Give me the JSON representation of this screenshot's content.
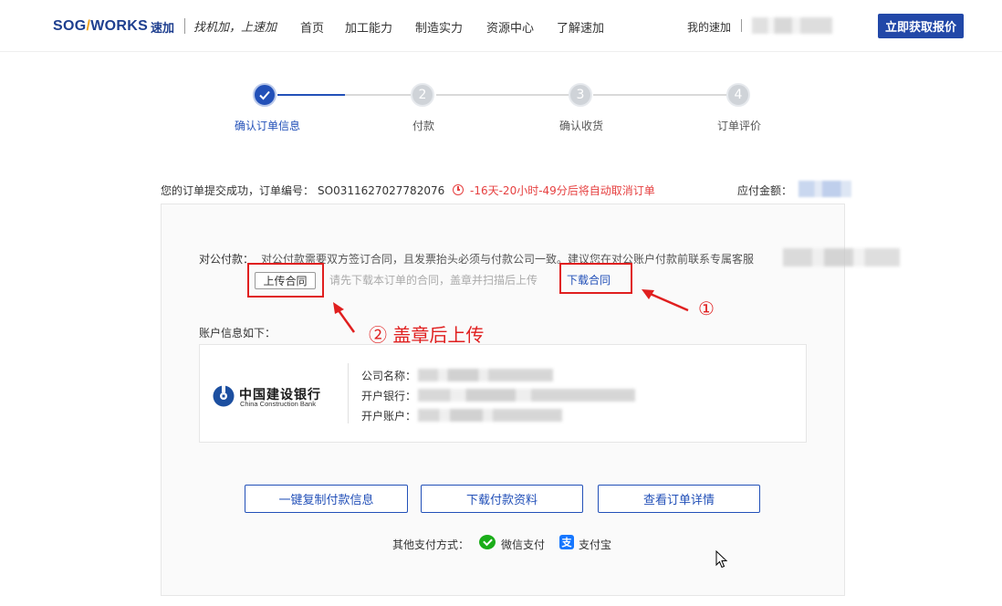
{
  "header": {
    "logo_main_a": "SOG",
    "logo_main_slash": "/",
    "logo_main_b": "WORKS",
    "logo_cn": "速加",
    "slogan": "找机加，上速加",
    "nav": [
      "首页",
      "加工能力",
      "制造实力",
      "资源中心",
      "了解速加"
    ],
    "my": "我的速加",
    "quote_button": "立即获取报价"
  },
  "steps": [
    {
      "num": "",
      "label": "确认订单信息",
      "done": true
    },
    {
      "num": "2",
      "label": "付款",
      "done": false
    },
    {
      "num": "3",
      "label": "确认收货",
      "done": false
    },
    {
      "num": "4",
      "label": "订单评价",
      "done": false
    }
  ],
  "order": {
    "submitted_text": "您的订单提交成功，订单编号：",
    "order_no": "SO0311627027782076",
    "countdown": "-16天-20小时-49分后将自动取消订单",
    "amount_label": "应付金额："
  },
  "payment": {
    "label": "对公付款：",
    "description": "对公付款需要双方签订合同，且发票抬头必须与付款公司一致。建议您在对公账户付款前联系专属客服",
    "upload_button": "上传合同",
    "upload_hint": "请先下载本订单的合同，盖章并扫描后上传",
    "download_link": "下载合同"
  },
  "annotations": {
    "one": "①",
    "two": "② 盖章后上传"
  },
  "account": {
    "title": "账户信息如下：",
    "bank_cn": "中国建设银行",
    "bank_en": "China Construction Bank",
    "company_label": "公司名称：",
    "bank_label": "开户银行：",
    "account_label": "开户账户："
  },
  "actions": {
    "copy": "一键复制付款信息",
    "download": "下载付款资料",
    "detail": "查看订单详情"
  },
  "other_pay": {
    "label": "其他支付方式：",
    "wechat": "微信支付",
    "alipay": "支付宝"
  },
  "colors": {
    "brand": "#2250b8",
    "warning": "#e64040",
    "annotation": "#e01f1f"
  }
}
